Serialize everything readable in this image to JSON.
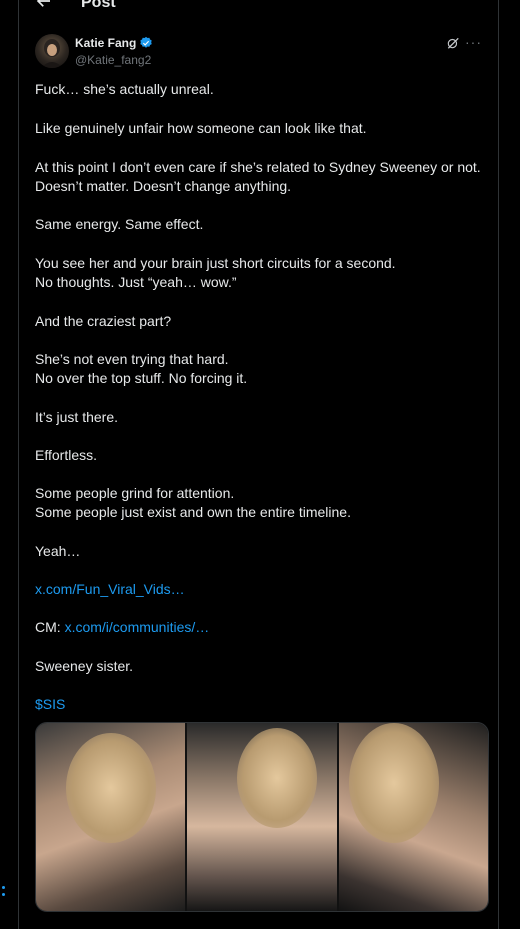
{
  "topbar": {
    "title": "Post"
  },
  "author": {
    "name": "Katie Fang",
    "handle": "@Katie_fang2"
  },
  "icons": {
    "back": "arrow-left-icon",
    "verified": "verified-badge-icon",
    "grok": "grok-icon",
    "more": "more-icon"
  },
  "colors": {
    "accent": "#1d9bf0",
    "background": "#000000",
    "text": "#e7e9ea",
    "muted": "#71767b"
  },
  "post": {
    "lines": [
      "Fuck… she’s actually unreal.",
      "Like genuinely unfair how someone can look like that.",
      "At this point I don’t even care if she’s related to Sydney Sweeney or not.\nDoesn’t matter. Doesn’t change anything.",
      "Same energy. Same effect.",
      "You see her and your brain just short circuits for a second.\nNo thoughts. Just “yeah… wow.”",
      "And the craziest part?",
      "She’s not even trying that hard.\nNo over the top stuff. No forcing it.",
      "It’s just there.",
      "Effortless.",
      "Some people grind for attention.\nSome people just exist and own the entire timeline.",
      "Yeah…"
    ],
    "link1": "x.com/Fun_Viral_Vids…",
    "cm_prefix": "CM: ",
    "link2": "x.com/i/communities/…",
    "tail": "Sweeney sister.",
    "cashtag": "$SIS"
  },
  "more_glyph": "···"
}
